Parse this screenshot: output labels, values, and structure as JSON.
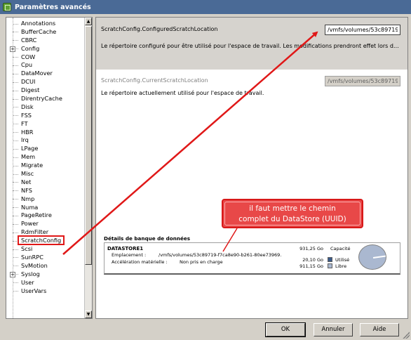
{
  "window": {
    "title": "Paramètres avancés"
  },
  "tree": {
    "items": [
      {
        "label": "Annotations",
        "expandable": false
      },
      {
        "label": "BufferCache",
        "expandable": false
      },
      {
        "label": "CBRC",
        "expandable": false
      },
      {
        "label": "Config",
        "expandable": true
      },
      {
        "label": "COW",
        "expandable": false
      },
      {
        "label": "Cpu",
        "expandable": false
      },
      {
        "label": "DataMover",
        "expandable": false
      },
      {
        "label": "DCUI",
        "expandable": false
      },
      {
        "label": "Digest",
        "expandable": false
      },
      {
        "label": "DirentryCache",
        "expandable": false
      },
      {
        "label": "Disk",
        "expandable": false
      },
      {
        "label": "FSS",
        "expandable": false
      },
      {
        "label": "FT",
        "expandable": false
      },
      {
        "label": "HBR",
        "expandable": false
      },
      {
        "label": "Irq",
        "expandable": false
      },
      {
        "label": "LPage",
        "expandable": false
      },
      {
        "label": "Mem",
        "expandable": false
      },
      {
        "label": "Migrate",
        "expandable": false
      },
      {
        "label": "Misc",
        "expandable": false
      },
      {
        "label": "Net",
        "expandable": false
      },
      {
        "label": "NFS",
        "expandable": false
      },
      {
        "label": "Nmp",
        "expandable": false
      },
      {
        "label": "Numa",
        "expandable": false
      },
      {
        "label": "PageRetire",
        "expandable": false
      },
      {
        "label": "Power",
        "expandable": false
      },
      {
        "label": "RdmFilter",
        "expandable": false
      },
      {
        "label": "ScratchConfig",
        "expandable": false,
        "selected": true
      },
      {
        "label": "Scsi",
        "expandable": false
      },
      {
        "label": "SunRPC",
        "expandable": false
      },
      {
        "label": "SvMotion",
        "expandable": false
      },
      {
        "label": "Syslog",
        "expandable": true
      },
      {
        "label": "User",
        "expandable": false
      },
      {
        "label": "UserVars",
        "expandable": false
      }
    ],
    "expand_glyph": "+"
  },
  "options": {
    "configured": {
      "name": "ScratchConfig.ConfiguredScratchLocation",
      "value": "/vmfs/volumes/53c89719-f",
      "description": "Le répertoire configuré pour être utilisé pour l'espace de travail. Les modifications prendront effet lors du..."
    },
    "current": {
      "name": "ScratchConfig.CurrentScratchLocation",
      "value": "/vmfs/volumes/53c89719-f",
      "description": "Le répertoire actuellement utilisé pour l'espace de travail."
    }
  },
  "datastore": {
    "section_title": "Détails de banque de données",
    "name": "DATASTORE1",
    "location_label": "Emplacement :",
    "location_value": "/vmfs/volumes/53c89719-f7ca8e90-b261-80ee73969...",
    "accel_label": "Accélération matérielle :",
    "accel_value": "Non pris en charge",
    "capacity_value": "931,25 Go",
    "capacity_label": "Capacité",
    "used_value": "20,10 Go",
    "used_label": "Utilisé",
    "free_value": "911,15 Go",
    "free_label": "Libre",
    "used_fraction": 0.0216,
    "colors": {
      "used": "#3a5a8a",
      "free": "#aab8d0"
    }
  },
  "callout": {
    "line1": "il faut mettre le chemin",
    "line2": "complet du DataStore (UUID)"
  },
  "buttons": {
    "ok": "OK",
    "cancel": "Annuler",
    "help": "Aide"
  },
  "colors": {
    "annotation_red": "#e01818",
    "titlebar": "#4a6a96"
  }
}
